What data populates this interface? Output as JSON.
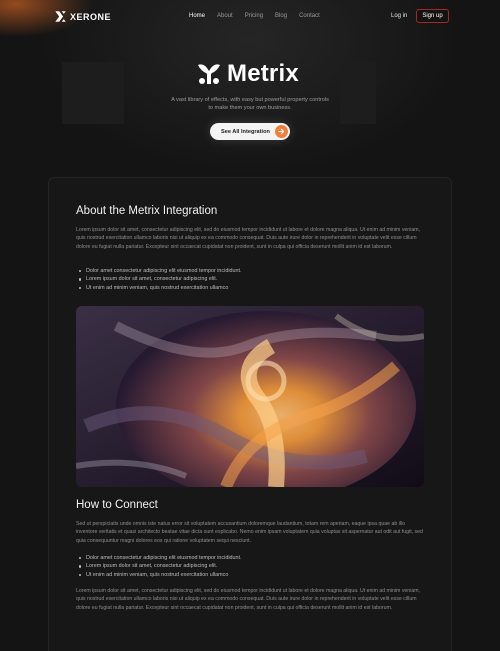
{
  "nav": {
    "brand": "XERONE",
    "links": [
      "Home",
      "About",
      "Pricing",
      "Blog",
      "Contact"
    ],
    "login": "Log in",
    "signup": "Sign up"
  },
  "hero": {
    "title": "Metrix",
    "description": "A vast library of effects, with easy but powerful property controls to make them your own business.",
    "cta": "See All Integration"
  },
  "content": {
    "about_heading": "About the Metrix Integration",
    "about_para": "Lorem ipsum dolor sit amet, consectetur adipiscing elit, sed do eiusmod tempor incididunt ut labore et dolore magna aliqua. Ut enim ad minim veniam, quis nostrud exercitation ullamco laboris nisi ut aliquip ex ea commodo consequat. Duis aute irure dolor in reprehenderit in voluptate velit esse cillum dolore eu fugiat nulla pariatur. Excepteur sint occaecat cupidatat non proident, sunt in culpa qui officia deserunt mollit anim id est laborum.",
    "about_bullets": [
      "Dolor amet consectetur adipiscing elit eiusmod tempor incididunt.",
      "Lorem ipsum dolor sit amet, consectetur adipiscing elit.",
      "Ut enim ad minim veniam, quis nostrud exercitation ullamco"
    ],
    "connect_heading": "How to Connect",
    "connect_para": "Sed ut perspiciatis unde omnis iste natus error sit voluptatem accusantium doloremque laudantium, totam rem aperiam, eaque ipsa quae ab illo inventore veritatis et quasi architecto beatae vitae dicta sunt explicabo. Nemo enim ipsam voluptatem quia voluptas sit aspernatur aut odit aut fugit, sed quia consequuntur magni dolores eos qui ratione voluptatem sequi nesciunt.",
    "connect_bullets": [
      "Dolor amet consectetur adipiscing elit eiusmod tempor incididunt.",
      "Lorem ipsum dolor sit amet, consectetur adipiscing elit.",
      "Ut enim ad minim veniam, quis nostrud exercitation ullamco"
    ],
    "final_para": "Lorem ipsum dolor sit amet, consectetur adipiscing elit, sed do eiusmod tempor incididunt ut labore et dolore magna aliqua. Ut enim ad minim veniam, quis nostrud exercitation ullamco laboris nisi ut aliquip ex ea commodo consequat. Duis aute irure dolor in reprehenderit in voluptate velit esse cillum dolore eu fugiat nulla pariatur. Excepteur sint occaecat cupidatat non proident, sunt in culpa qui officia deserunt mollit anim id est laborum."
  },
  "colors": {
    "accent": "#f07f3c",
    "signup_border": "#9d2a2a",
    "background": "#141414"
  },
  "icons": [
    "xerone-logo-icon",
    "metrix-logo-icon",
    "arrow-right-icon"
  ]
}
